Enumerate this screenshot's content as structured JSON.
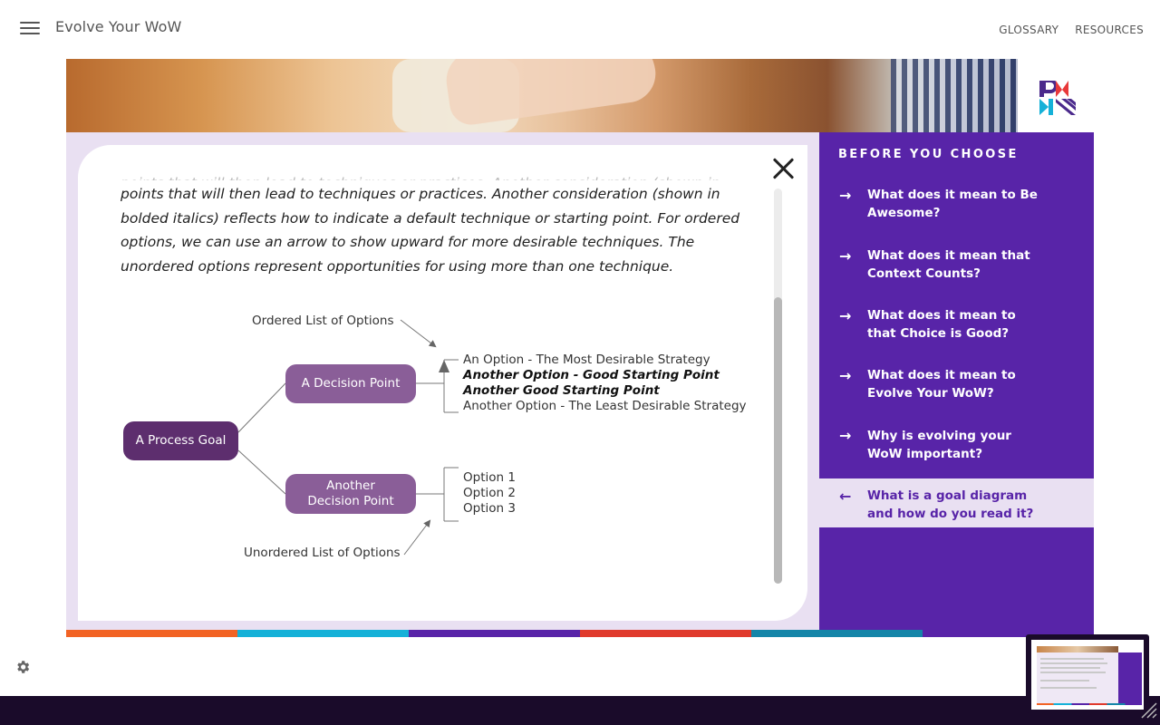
{
  "app": {
    "title": "Evolve Your WoW"
  },
  "topnav": {
    "glossary": "GLOSSARY",
    "resources": "RESOURCES"
  },
  "content": {
    "paragraph_fragment": "points that will then lead to techniques or practices. Another consideration (shown in bolded italics) reflects how to indicate a default technique or starting point. For ordered options, we can use an arrow to show upward for more desirable techniques. The unordered options represent opportunities for using more than one technique."
  },
  "diagram": {
    "process_goal": "A Process Goal",
    "decision_point_1": "A Decision Point",
    "decision_point_2": "Another Decision Point",
    "ordered_label": "Ordered List of Options",
    "unordered_label": "Unordered List of Options",
    "ordered_options": [
      "An Option - The Most Desirable Strategy",
      "Another Option - Good Starting Point",
      "Another Good Starting Point",
      "Another Option - The Least Desirable Strategy"
    ],
    "unordered_options": [
      "Option 1",
      "Option 2",
      "Option 3"
    ]
  },
  "sidebar": {
    "title": "BEFORE YOU CHOOSE",
    "items": [
      {
        "label": "What does it mean to Be Awesome?"
      },
      {
        "label": "What does it mean that Context Counts?"
      },
      {
        "label": "What does it mean to that Choice is Good?"
      },
      {
        "label": "What does it mean to Evolve Your WoW?"
      },
      {
        "label": "Why is evolving your WoW important?"
      },
      {
        "label": "What is a goal diagram and how do you read it?"
      }
    ],
    "active_index": 5
  },
  "colors": {
    "brand_purple": "#5824a8",
    "light_purple": "#e9e0f2",
    "strip": [
      "#f26324",
      "#15b1d8",
      "#5824a8",
      "#e03a2c",
      "#1485a8",
      "#5824a8"
    ]
  }
}
